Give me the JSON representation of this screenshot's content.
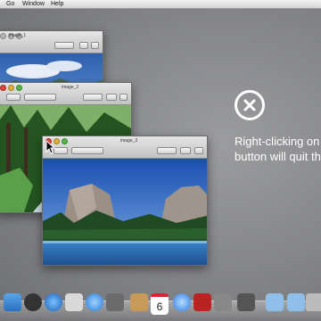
{
  "menubar": {
    "items": [
      "Go",
      "Window",
      "Help"
    ]
  },
  "windows": [
    {
      "title": "image_1"
    },
    {
      "title": "image_2"
    },
    {
      "title": "image_3"
    }
  ],
  "message": {
    "icon": "circle-x-icon",
    "line1": "Right-clicking on",
    "line2": "button will quit th"
  },
  "dock": {
    "calendar_day": "6",
    "icons": [
      "finder-icon",
      "dashboard-icon",
      "launchpad-icon",
      "safari-icon",
      "mail-icon",
      "contacts-icon",
      "calendar-icon",
      "itunes-icon",
      "photo-booth-icon",
      "app-store-icon",
      "system-preferences-icon",
      "preview-icon",
      "folder-icon",
      "folder-icon",
      "trash-icon"
    ]
  },
  "colors": {
    "close": "#e0443e",
    "minimize": "#e2b33a",
    "zoom": "#54b54a"
  }
}
